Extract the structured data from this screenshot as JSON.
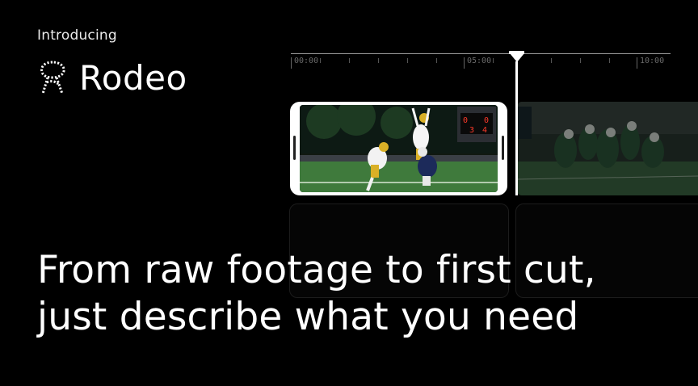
{
  "eyebrow": "Introducing",
  "brand": {
    "name": "Rodeo",
    "icon": "rodeo-logo-icon"
  },
  "timeline": {
    "labels": [
      "00:00",
      "05:00",
      "10:00"
    ]
  },
  "clips": {
    "selected": {
      "description_icon": "football-clip-thumbnail"
    },
    "next": {
      "description_icon": "football-clip-thumbnail-2"
    }
  },
  "headline": {
    "line1": "From raw footage to first cut,",
    "line2": "just describe what you need"
  },
  "colors": {
    "background": "#000000",
    "text": "#ffffff",
    "accent_clip_border": "#ffffff"
  }
}
